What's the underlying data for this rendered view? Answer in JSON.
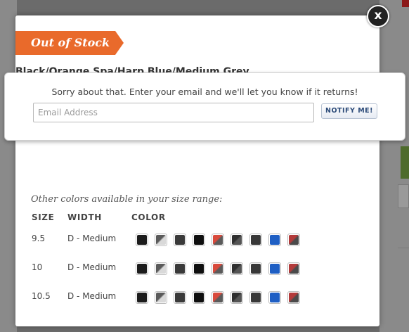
{
  "modal": {
    "ribbon_label": "Out of Stock",
    "obscured_title": "Black/Orange Spa/Harp Blue/Medium Grey Blue",
    "notify": {
      "message": "Sorry about that. Enter your email and we'll let you know if it returns!",
      "email_placeholder": "Email Address",
      "button_label": "NOTIFY ME!"
    },
    "other_colors_heading": "Other colors available in your size range:",
    "table_headers": {
      "size": "SIZE",
      "width": "WIDTH",
      "color": "COLOR"
    },
    "rows": [
      {
        "size": "9.5",
        "width": "D - Medium"
      },
      {
        "size": "10",
        "width": "D - Medium"
      },
      {
        "size": "10.5",
        "width": "D - Medium"
      }
    ],
    "swatches": [
      {
        "name": "black",
        "color": "#1c1c1c"
      },
      {
        "name": "grey-white",
        "color": "linear-gradient(135deg,#5a5a5a 45%,#d9d9d9 55%)"
      },
      {
        "name": "dark-grey",
        "color": "#3a3a3a"
      },
      {
        "name": "black-2",
        "color": "#0f0f0f"
      },
      {
        "name": "red-grey",
        "color": "linear-gradient(135deg,#d94a3c 45%,#5b5b5b 55%)"
      },
      {
        "name": "charcoal",
        "color": "linear-gradient(135deg,#2f2f2f 45%,#555 55%)"
      },
      {
        "name": "slate",
        "color": "#383838"
      },
      {
        "name": "blue",
        "color": "#1f5fc4"
      },
      {
        "name": "red-dark",
        "color": "linear-gradient(135deg,#b33a3a 45%,#4a4a4a 55%)"
      }
    ]
  },
  "close_label": "x"
}
